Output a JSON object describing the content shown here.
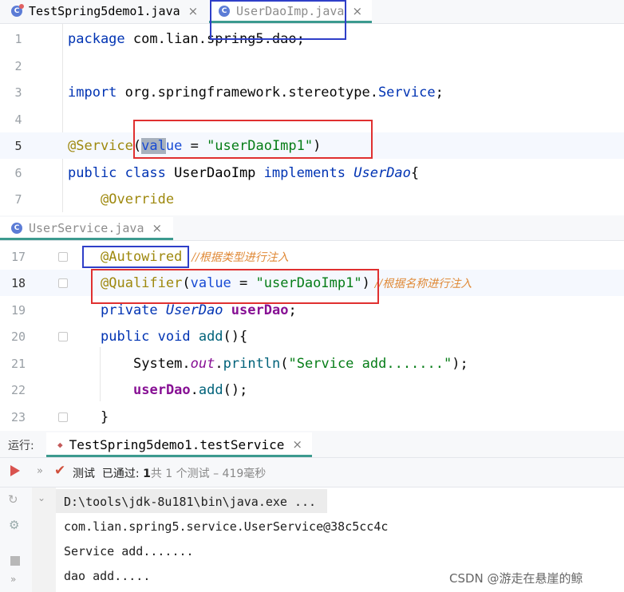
{
  "editor_top": {
    "tabs": [
      {
        "label": "TestSpring5demo1.java",
        "close": "×"
      },
      {
        "label": "UserDaoImp.java",
        "close": "×"
      }
    ],
    "lines": [
      {
        "n": "1",
        "code": {
          "kw": "package",
          "rest": " com.lian.spring5.dao;"
        }
      },
      {
        "n": "2"
      },
      {
        "n": "3",
        "code": {
          "kw": "import",
          "rest": " org.springframework.stereotype.",
          "type": "Service",
          "end": ";"
        }
      },
      {
        "n": "4"
      },
      {
        "n": "5",
        "code": {
          "ann": "@Service",
          "p1": "(",
          "sel": "val",
          "param": "ue",
          "eq": " = ",
          "str": "\"userDaoImp1\"",
          "p2": ")"
        }
      },
      {
        "n": "6",
        "code": {
          "kw1": "public class",
          "cls": " UserDaoImp ",
          "kw2": "implements",
          "iface": " UserDao",
          "brace": "{"
        }
      },
      {
        "n": "7",
        "code": {
          "ann": "@Override"
        }
      }
    ]
  },
  "editor_bottom": {
    "tab": {
      "label": "UserService.java",
      "close": "×"
    },
    "lines": [
      {
        "n": "17",
        "code": {
          "ann": "@Autowired",
          "comment": "//根据类型进行注入"
        }
      },
      {
        "n": "18",
        "code": {
          "ann": "@Qualifier",
          "p1": "(",
          "param": "value",
          "eq": " = ",
          "str": "\"userDaoImp1\"",
          "p2": ")",
          "comment": "//根据名称进行注入"
        }
      },
      {
        "n": "19",
        "code": {
          "kw": "private",
          "type": " UserDao ",
          "field": "userDao",
          "end": ";"
        }
      },
      {
        "n": "20",
        "code": {
          "kw": "public void",
          "method": " add",
          "end": "(){"
        }
      },
      {
        "n": "21",
        "code": {
          "a": "System.",
          "field": "out",
          "b": ".",
          "method": "println",
          "c": "(",
          "str": "\"Service add.......\"",
          "d": ");"
        }
      },
      {
        "n": "22",
        "code": {
          "field": "userDao",
          "b": ".",
          "method": "add",
          "end": "();"
        }
      },
      {
        "n": "23",
        "code": {
          "brace": "}"
        }
      }
    ]
  },
  "run": {
    "label": "运行:",
    "tab": {
      "label": "TestSpring5demo1.testService",
      "close": "×"
    },
    "status": {
      "test": "测试",
      "passed": "已通过:",
      "count": "1",
      "of": "共 1 个测试",
      "time": "– 419毫秒"
    },
    "output": [
      "D:\\tools\\jdk-8u181\\bin\\java.exe ...",
      "com.lian.spring5.service.UserService@38c5cc4c",
      "Service add.......",
      "dao add....."
    ]
  },
  "watermark": "CSDN @游走在悬崖的鲸",
  "colors": {
    "keyword": "#0033b3",
    "annotation": "#9e880d",
    "string": "#067d17",
    "field": "#871094",
    "method": "#00627a",
    "comment": "#e08a38",
    "active_tab": "#3c9a8f",
    "mark_red": "#e03030",
    "mark_blue": "#2f3fc8"
  }
}
